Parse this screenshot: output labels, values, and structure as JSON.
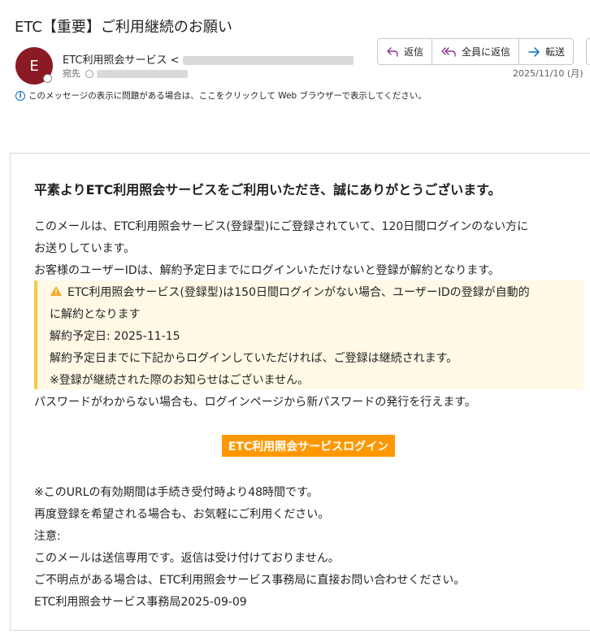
{
  "email": {
    "subject": "ETC【重要】ご利用継続のお願い",
    "avatar_initial": "E",
    "sender_name": "ETC利用照会サービス <",
    "to_label": "宛先",
    "date": "2025/11/10 (月)",
    "notice": "このメッセージの表示に問題がある場合は、ここをクリックして Web ブラウザーで表示してください。"
  },
  "actions": {
    "reply": "返信",
    "reply_all": "全員に返信",
    "forward": "転送"
  },
  "body": {
    "greeting": "平素よりETC利用照会サービスをご利用いただき、誠にありがとうございます。",
    "p1a": "このメールは、ETC利用照会サービス(登録型)にご登録されていて、120日間ログインのない方に",
    "p1b": "お送りしています。",
    "p2": "お客様のユーザーIDは、解約予定日までにログインいただけないと登録が解約となります。",
    "warn1": "ETC利用照会サービス(登録型)は150日間ログインがない場合、ユーザーIDの登録が自動的",
    "warn2": "に解約となります",
    "warn3": "解約予定日: 2025-11-15",
    "warn4": "解約予定日までに下記からログインしていただければ、ご登録は継続されます。",
    "warn5": "※登録が継続された際のお知らせはございません。",
    "p3": "パスワードがわからない場合も、ログインページから新パスワードの発行を行えます。",
    "login_button": "ETC利用照会サービスログイン",
    "p4": "※このURLの有効期間は手続き受付時より48時間です。",
    "p5": "再度登録を希望される場合も、お気軽にご利用ください。",
    "p6": "注意:",
    "p7": "このメールは送信専用です。返信は受け付けておりません。",
    "p8": "ご不明点がある場合は、ETC利用照会サービス事務局に直接お問い合わせください。",
    "p9": "ETC利用照会サービス事務局2025-09-09"
  },
  "icons": {
    "reply": "reply-icon",
    "reply_all": "reply-all-icon",
    "forward": "forward-icon",
    "info": "info-icon",
    "warning": "warning-icon"
  },
  "colors": {
    "avatar": "#8b1a24",
    "login_button": "#ff9800",
    "warn_bg": "#fff9e6",
    "warn_border": "#f7c948"
  }
}
